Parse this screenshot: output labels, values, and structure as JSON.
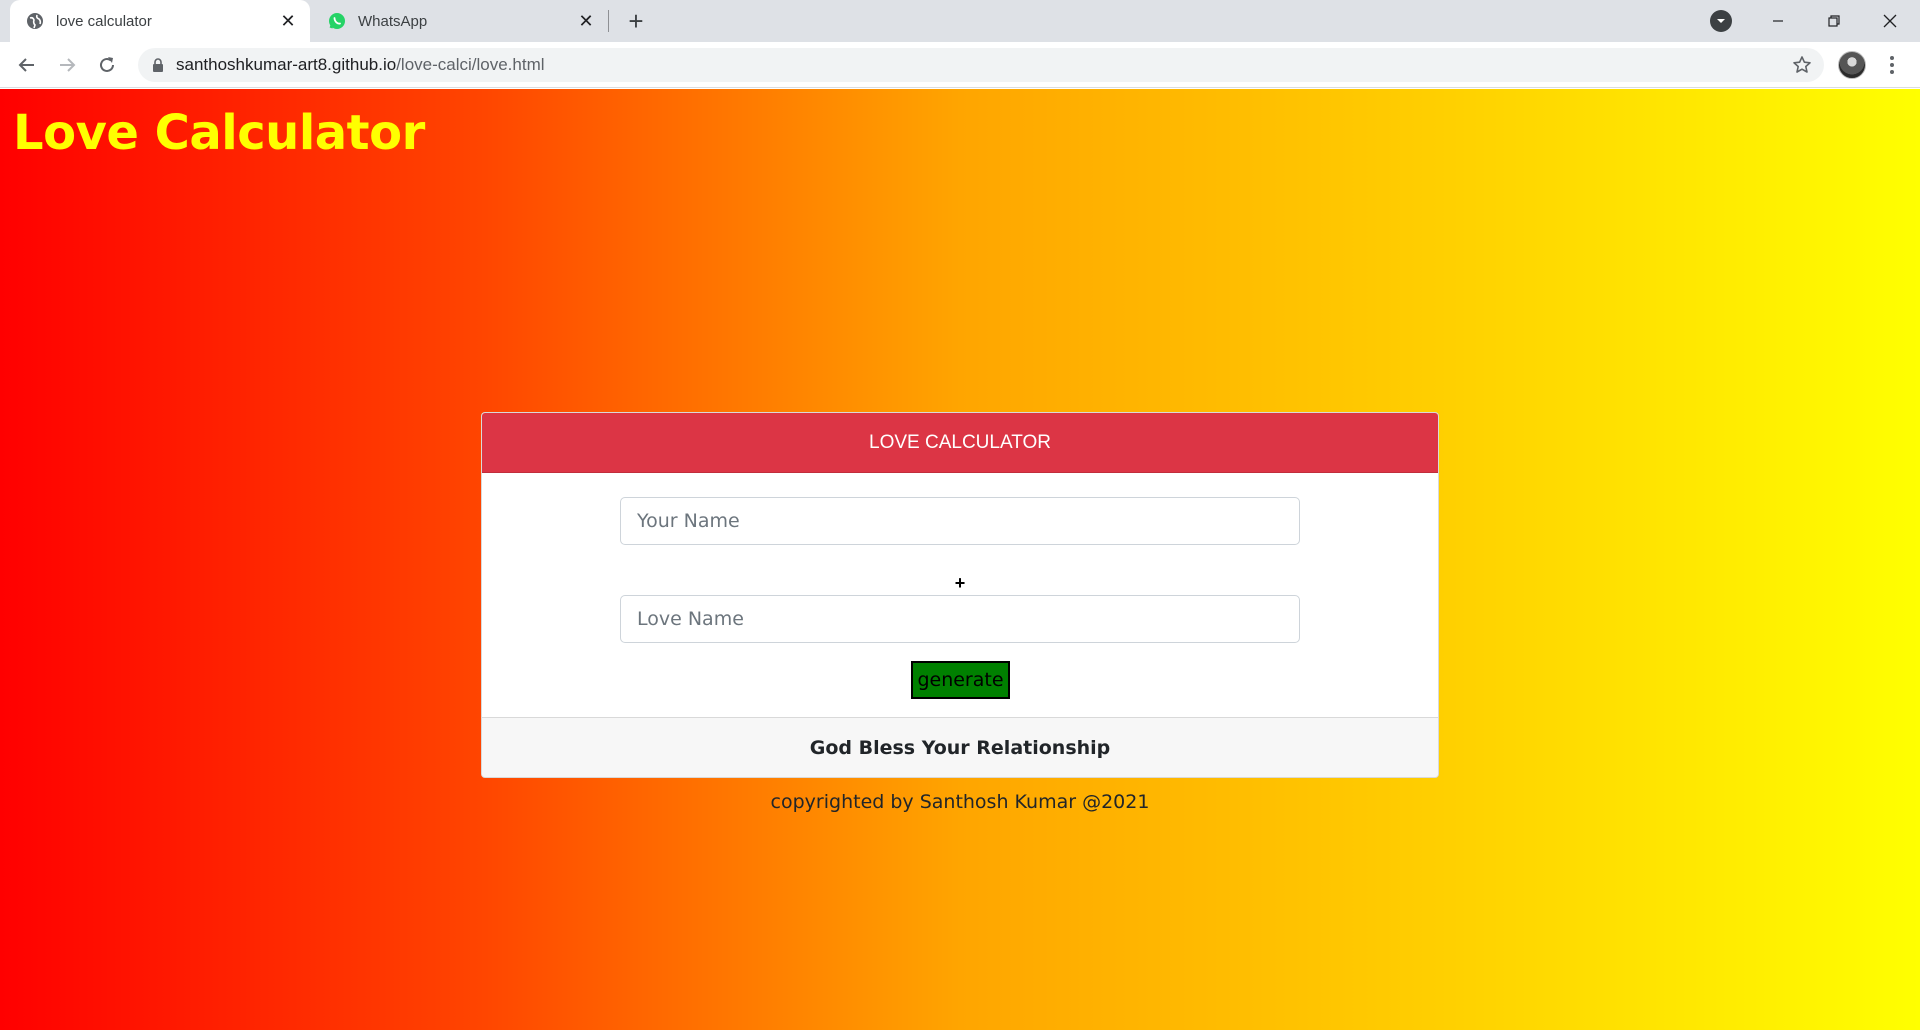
{
  "browser": {
    "tabs": [
      {
        "title": "love calculator",
        "icon": "globe-icon",
        "active": true
      },
      {
        "title": "WhatsApp",
        "icon": "whatsapp-icon",
        "active": false
      }
    ],
    "new_tab_label": "+",
    "address": {
      "host": "santhoshkumar-art8.github.io",
      "path": "/love-calci/love.html"
    }
  },
  "page": {
    "heading": "Love Calculator",
    "colors": {
      "gradient": [
        "#ff0000",
        "#ffa500",
        "#ffff00"
      ],
      "heading": "#ffff00",
      "card_header": "#dc3545",
      "button": "#008000"
    },
    "card": {
      "header": "LOVE CALCULATOR",
      "your_name_placeholder": "Your Name",
      "plus": "+",
      "love_name_placeholder": "Love Name",
      "button_label": "generate",
      "footer": "God Bless Your Relationship"
    },
    "copyright": "copyrighted by Santhosh Kumar @2021"
  }
}
